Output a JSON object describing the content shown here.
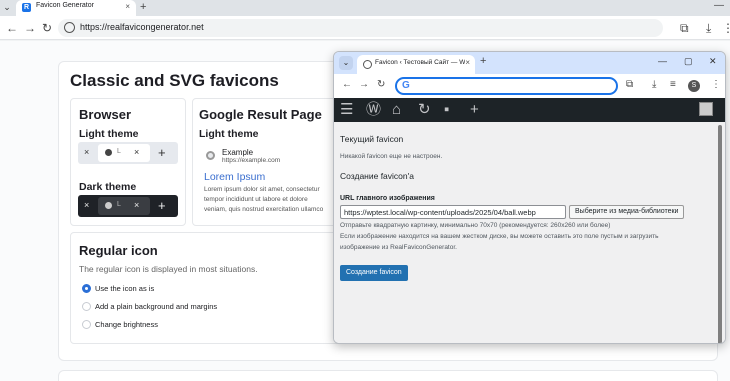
{
  "back_browser": {
    "tab_title": "Favicon Generator",
    "tab_close": "×",
    "new_tab": "+",
    "window_min": "—",
    "url": "https://realfavicongenerator.net"
  },
  "page": {
    "title": "Classic and SVG favicons",
    "browser": {
      "title": "Browser",
      "light_theme": "Light theme",
      "dark_theme": "Dark theme",
      "tab_label": "L",
      "close": "×",
      "plus": "+"
    },
    "google": {
      "title": "Google Result Page",
      "light_theme": "Light theme",
      "site_name": "Example",
      "site_url": "https://example.com",
      "link_title": "Lorem Ipsum",
      "snippet": [
        "Lorem ipsum dolor sit amet, consectetur",
        "tempor incididunt ut labore et dolore",
        "veniam, quis nostrud exercitation ullamco"
      ]
    },
    "regular": {
      "title": "Regular icon",
      "description": "The regular icon is displayed in most situations.",
      "options": [
        {
          "label": "Use the icon as is",
          "checked": true
        },
        {
          "label": "Add a plain background and margins",
          "checked": false
        },
        {
          "label": "Change brightness",
          "checked": false
        }
      ]
    }
  },
  "front_browser": {
    "tab_title": "Favicon ‹ Тестовый Сайт — WordPress",
    "tab_close": "×",
    "new_tab": "+",
    "omnibox_letter": "G",
    "avatar_letter": "S"
  },
  "wp": {
    "current_favicon_heading": "Текущий favicon",
    "no_favicon": "Никакой favicon еще не настроен.",
    "create_heading": "Создание favicon'a",
    "url_label": "URL главного изображения",
    "url_value": "https://wptest.local/wp-content/uploads/2025/04/ball.webp",
    "media_button": "Выберите из медиа-библиотеки",
    "hint1": "Отправьте квадратную картинку, минимально 70x70 (рекомендуется: 260x260 или более)",
    "hint2": "Если изображение находится на вашем жестком диске, вы можете оставить это поле пустым и загрузить",
    "hint3": "изображение из RealFaviconGenerator.",
    "create_button": "Создание favicon"
  },
  "colors": {
    "accent": "#2b6fd6",
    "wp_button": "#2271b1",
    "wp_admin_bar": "#1d2327",
    "link": "#3b6fcf"
  }
}
